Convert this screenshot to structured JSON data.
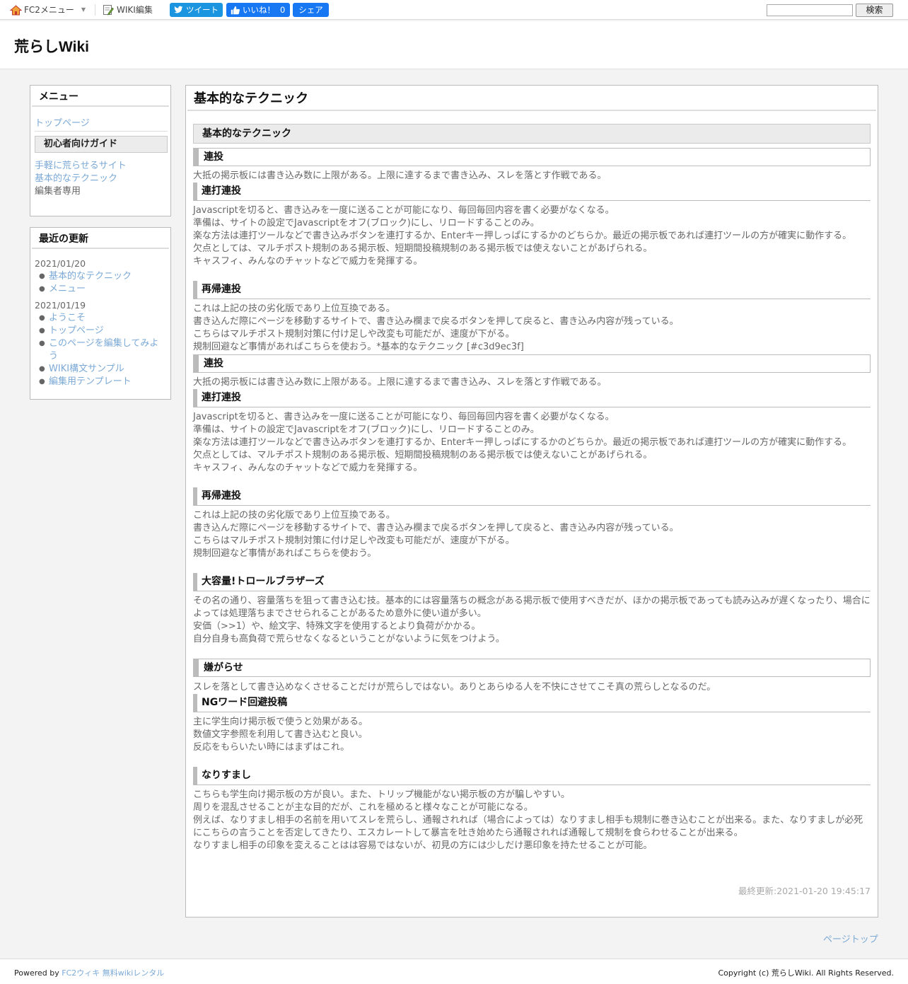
{
  "topbar": {
    "fc2_menu": "FC2メニュー",
    "wiki_edit": "WIKI編集",
    "tweet": "ツイート",
    "like": "いいね！",
    "like_count": "0",
    "share": "シェア",
    "search_button": "検索",
    "search_value": ""
  },
  "site": {
    "title": "荒らしWiki"
  },
  "menu": {
    "title": "メニュー",
    "top_page": "トップページ",
    "section": "初心者向けガイド",
    "items": [
      "手軽に荒らせるサイト",
      "基本的なテクニック"
    ],
    "editor_only": "編集者専用"
  },
  "updates": {
    "title": "最近の更新",
    "groups": [
      {
        "date": "2021/01/20",
        "items": [
          "基本的なテクニック",
          "メニュー"
        ]
      },
      {
        "date": "2021/01/19",
        "items": [
          "ようこそ",
          "トップページ",
          "このページを編集してみよう",
          "WIKI構文サンプル",
          "編集用テンプレート"
        ]
      }
    ]
  },
  "main": {
    "title": "基本的なテクニック",
    "section_title": "基本的なテクニック",
    "h_renso": "連投",
    "p_renso": "大抵の掲示板には書き込み数に上限がある。上限に達するまで書き込み、スレを落とす作戦である。",
    "h_renda": "連打連投",
    "p_renda": [
      "Javascriptを切ると、書き込みを一度に送ることが可能になり、毎回毎回内容を書く必要がなくなる。",
      "準備は、サイトの設定でJavascriptをオフ(ブロック)にし、リロードすることのみ。",
      "楽な方法は連打ツールなどで書き込みボタンを連打するか、Enterキー押しっぱにするかのどちらか。最近の掲示板であれば連打ツールの方が確実に動作する。",
      "欠点としては、マルチポスト規制のある掲示板、短期間投稿規制のある掲示板では使えないことがあげられる。",
      "キャスフィ、みんなのチャットなどで威力を発揮する。"
    ],
    "h_saiki": "再帰連投",
    "p_saiki": [
      "これは上記の技の劣化版であり上位互換である。",
      "書き込んだ際にページを移動するサイトで、書き込み欄まで戻るボタンを押して戻ると、書き込み内容が残っている。",
      "こちらはマルチポスト規制対策に付け足しや改変も可能だが、速度が下がる。"
    ],
    "p_saiki_last_1": "規制回避など事情があればこちらを使おう。*基本的なテクニック [#c3d9ec3f]",
    "p_saiki_last_2": "規制回避など事情があればこちらを使おう。",
    "h_troll": "大容量!トロールブラザーズ",
    "p_troll": [
      "その名の通り、容量落ちを狙って書き込む技。基本的には容量落ちの概念がある掲示板で使用すべきだが、ほかの掲示板であっても読み込みが遅くなったり、場合によっては処理落ちまでさせられることがあるため意外に使い道が多い。",
      "安価（>>1）や、絵文字、特殊文字を使用するとより負荷がかかる。",
      "自分自身も高負荷で荒らせなくなるということがないように気をつけよう。"
    ],
    "h_iyagarase": "嫌がらせ",
    "p_iyagarase": "スレを落として書き込めなくさせることだけが荒らしではない。ありとあらゆる人を不快にさせてこそ真の荒らしとなるのだ。",
    "h_ng": "NGワード回避投稿",
    "p_ng": [
      "主に学生向け掲示板で使うと効果がある。",
      "数値文字参照を利用して書き込むと良い。",
      "反応をもらいたい時にはまずはこれ。"
    ],
    "h_narisumashi": "なりすまし",
    "p_narisumashi": [
      "こちらも学生向け掲示板の方が良い。また、トリップ機能がない掲示板の方が騙しやすい。",
      "周りを混乱させることが主な目的だが、これを極めると様々なことが可能になる。",
      "例えば、なりすまし相手の名前を用いてスレを荒らし、通報されれば（場合によっては）なりすまし相手も規制に巻き込むことが出来る。また、なりすましが必死にこちらの言うことを否定してきたり、エスカレートして暴言を吐き始めたら通報されれば通報して規制を食らわせることが出来る。",
      "なりすまし相手の印象を変えることはは容易ではないが、初見の方には少しだけ悪印象を持たせることが可能。"
    ],
    "last_updated": "最終更新:2021-01-20 19:45:17"
  },
  "page_top": "ページトップ",
  "footer": {
    "powered_by": "Powered by",
    "fc2_wiki": "FC2ウィキ",
    "rental": "無料wikiレンタル",
    "copyright": "Copyright (c) 荒らしWiki. All Rights Reserved."
  }
}
